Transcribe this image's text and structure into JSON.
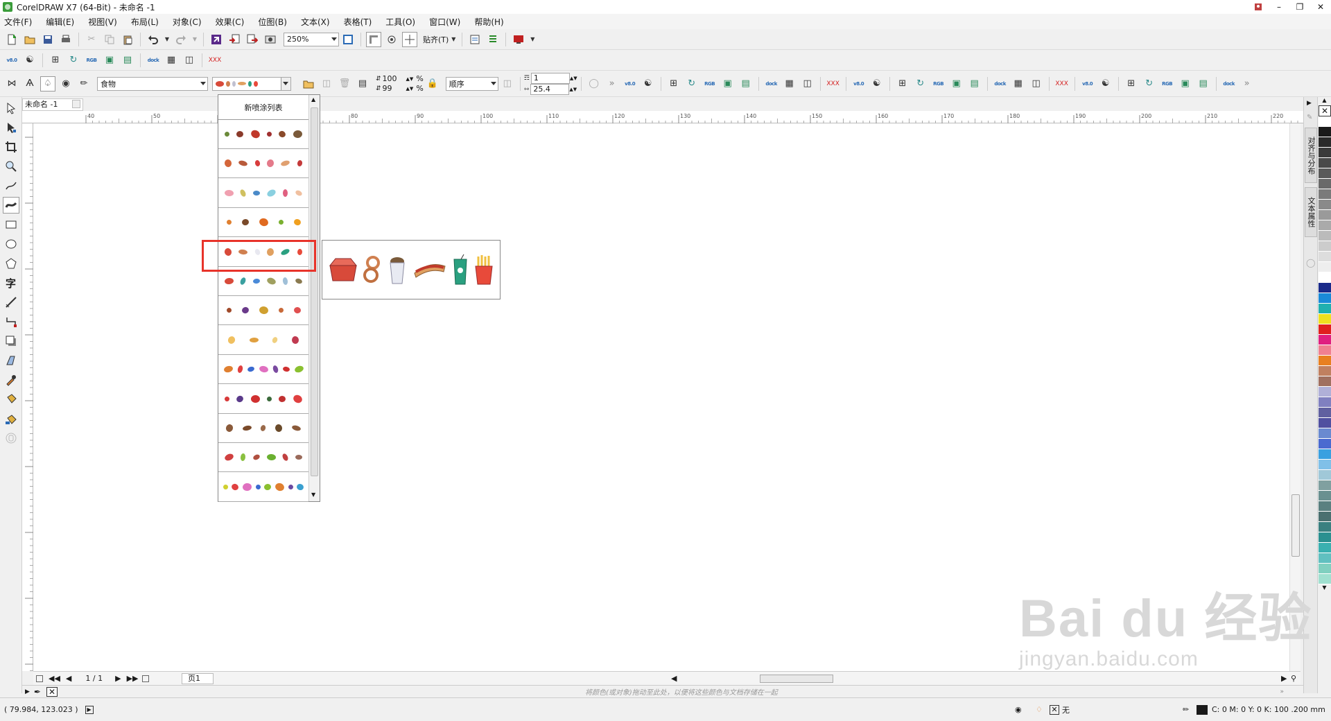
{
  "window": {
    "title": "CorelDRAW X7 (64-Bit) - 未命名 -1"
  },
  "menu": [
    "文件(F)",
    "编辑(E)",
    "视图(V)",
    "布局(L)",
    "对象(C)",
    "效果(C)",
    "位图(B)",
    "文本(X)",
    "表格(T)",
    "工具(O)",
    "窗口(W)",
    "帮助(H)"
  ],
  "toolbar": {
    "zoom_value": "250%",
    "snap_label": "贴齐(T)"
  },
  "property_bar": {
    "category_value": "食物",
    "width_value": "100",
    "height_value": "99",
    "percent_label": "%",
    "order_value": "顺序",
    "spacing_value": "1",
    "size_value": "25.4"
  },
  "document": {
    "tab_label": "未命名 -1",
    "page_counter": "1 / 1",
    "page_tab": "页1"
  },
  "ruler": {
    "ticks": [
      "40",
      "50",
      "60",
      "70",
      "80",
      "90",
      "100",
      "110",
      "120",
      "130",
      "140",
      "150",
      "160",
      "170",
      "180",
      "190",
      "200",
      "210",
      "220"
    ]
  },
  "dropdown": {
    "header": "新喷涂列表",
    "rows": [
      {
        "name": "vegetables",
        "colors": [
          "#6b8a3a",
          "#8a3a2a",
          "#c0392b",
          "#a03030",
          "#8a4a2a",
          "#7a5a3a"
        ]
      },
      {
        "name": "meats",
        "colors": [
          "#d4663a",
          "#b85a3a",
          "#d83c3c",
          "#e47a8a",
          "#e0a070",
          "#c43a3a"
        ]
      },
      {
        "name": "desserts",
        "colors": [
          "#f0a0b0",
          "#d0c060",
          "#4a8ac8",
          "#8ad0e0",
          "#e06080",
          "#f0c0a0"
        ]
      },
      {
        "name": "fruits",
        "colors": [
          "#e08030",
          "#7a4a2a",
          "#e06a20",
          "#7ab030",
          "#f0a020"
        ]
      },
      {
        "name": "fast-food",
        "colors": [
          "#d84a3a",
          "#d08050",
          "#e8e8f0",
          "#e0a060",
          "#2aa080",
          "#e84a3a"
        ]
      },
      {
        "name": "snacks",
        "colors": [
          "#d84a3a",
          "#3aa0a0",
          "#4a8ad8",
          "#a0a060",
          "#a0c0d8",
          "#8a7a50"
        ]
      },
      {
        "name": "candies",
        "colors": [
          "#a04a2a",
          "#6a3a8a",
          "#d0a030",
          "#c86a3a",
          "#e05050"
        ]
      },
      {
        "name": "drinks",
        "colors": [
          "#f0c060",
          "#e0a040",
          "#f0d080",
          "#c03a50"
        ]
      },
      {
        "name": "jelly-beans",
        "colors": [
          "#e08030",
          "#e04040",
          "#3a6ad0",
          "#e070c0",
          "#7a4aa0",
          "#d03030",
          "#8ac030"
        ]
      },
      {
        "name": "berries",
        "colors": [
          "#d83a3a",
          "#5a3a8a",
          "#d03030",
          "#3a6a3a",
          "#c03030",
          "#e04040"
        ]
      },
      {
        "name": "chocolate",
        "colors": [
          "#8a5a3a",
          "#7a4a2a",
          "#9a6a4a",
          "#6a4a2a",
          "#8a5a3a"
        ]
      },
      {
        "name": "peppers",
        "colors": [
          "#d04040",
          "#8ac040",
          "#b05040",
          "#6ab030",
          "#c04040",
          "#9a6a5a"
        ]
      },
      {
        "name": "gummies",
        "colors": [
          "#d0d030",
          "#e04040",
          "#e070c0",
          "#3a6ad0",
          "#8ac030",
          "#e08030",
          "#6a4aa0",
          "#3aa0d0"
        ]
      }
    ]
  },
  "preview": {
    "colors": [
      "#d84a3a",
      "#d08050",
      "#e8e8f0",
      "#e0a060",
      "#2aa080",
      "#e84a3a"
    ]
  },
  "colorbar": {
    "hint": "将颜色(或对象)拖动至此处，以便将这些颜色与文档存储在一起"
  },
  "status": {
    "coordinates": "( 79.984, 123.023 )",
    "fill_none": "无",
    "color_info": "C: 0 M: 0 Y: 0 K: 100  .200 mm"
  },
  "dock": {
    "tab1": "对齐与分布",
    "tab2": "文本属性"
  },
  "palette": [
    "#ffffff",
    "#1a1a1a",
    "#2a2a2a",
    "#3a3a3a",
    "#4a4a4a",
    "#5a5a5a",
    "#6a6a6a",
    "#7a7a7a",
    "#8a8a8a",
    "#9a9a9a",
    "#aaaaaa",
    "#bbbbbb",
    "#cccccc",
    "#dddddd",
    "#eeeeee",
    "#ffffff",
    "#1a2a8a",
    "#1a8ad8",
    "#20b0b0",
    "#f0e020",
    "#e02020",
    "#e02080",
    "#f08090",
    "#e88020",
    "#c08060",
    "#a07060",
    "#b0b0d8",
    "#8080c0",
    "#6060a0",
    "#5050a0",
    "#6a8ad0",
    "#4a6ad0",
    "#3aa0e0",
    "#80c0e8",
    "#a0c8d8",
    "#80a0a0",
    "#6a9090",
    "#5a8080",
    "#4a7070",
    "#3a8080",
    "#2a9090",
    "#3ab0b0",
    "#60c0c0",
    "#80d0c0",
    "#a0e0d0"
  ],
  "watermark": {
    "line1": "Bai du 经验",
    "line2": "jingyan.baidu.com"
  }
}
